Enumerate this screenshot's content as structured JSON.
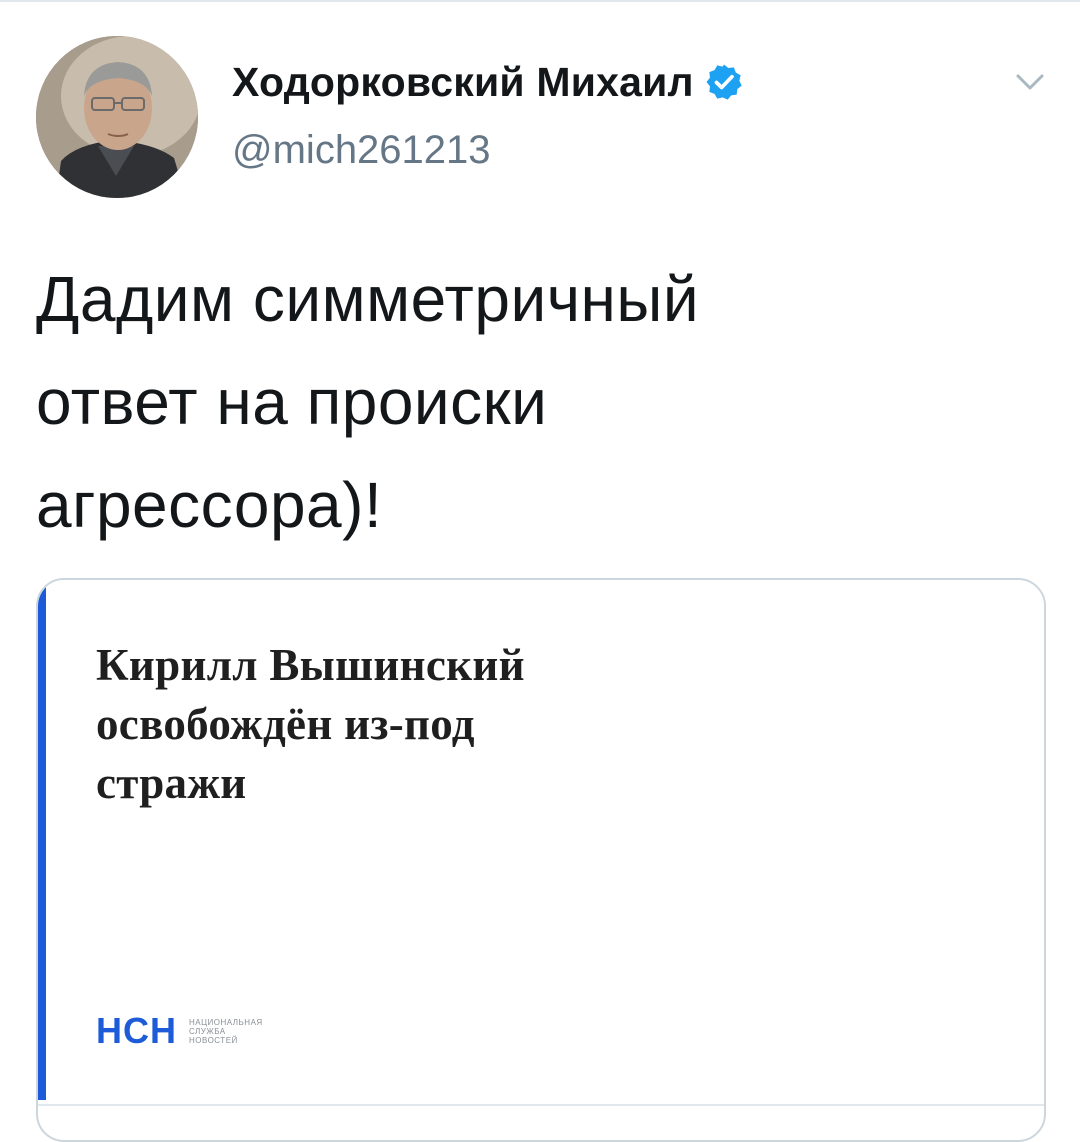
{
  "author": {
    "name": "Ходорковский Михаил",
    "handle": "@mich261213",
    "verified": true
  },
  "tweet": {
    "text": "Дадим симметричный\nответ на происки\nагрессора)!"
  },
  "card": {
    "headline": "Кирилл Вышинский\nосвобождён из-под\nстражи",
    "logo_text": "НСН",
    "logo_subtext": "Национальная\nслужба\nновостей",
    "accent_color": "#1d5bd8"
  },
  "icons": {
    "verified": "verified-badge-icon",
    "menu": "chevron-down-icon"
  },
  "colors": {
    "verified_blue": "#1da1f2",
    "handle_gray": "#657786",
    "nsn_blue": "#1d5bd8"
  }
}
